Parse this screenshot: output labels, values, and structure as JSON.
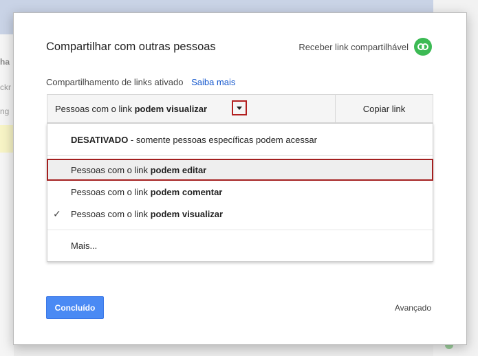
{
  "background": {
    "cells": [
      "ha",
      "ckr",
      "ng"
    ]
  },
  "dialog": {
    "title": "Compartilhar com outras pessoas",
    "share_link_label": "Receber link compartilhável",
    "link_sharing_status": "Compartilhamento de links ativado",
    "learn_more": "Saiba mais",
    "access": {
      "prefix": "Pessoas com o link ",
      "level": "podem visualizar"
    },
    "copy_link": "Copiar link",
    "menu": {
      "off_bold": "DESATIVADO",
      "off_rest": " - somente pessoas específicas podem acessar",
      "edit_prefix": "Pessoas com o link ",
      "edit_bold": "podem editar",
      "comment_prefix": "Pessoas com o link ",
      "comment_bold": "podem comentar",
      "view_prefix": "Pessoas com o link ",
      "view_bold": "podem visualizar",
      "more": "Mais..."
    },
    "done_button": "Concluído",
    "advanced": "Avançado"
  },
  "colors": {
    "accent_blue": "#4a8af4",
    "link_blue": "#1155cc",
    "green_icon": "#3cba54",
    "highlight_red": "#a31f1f"
  }
}
